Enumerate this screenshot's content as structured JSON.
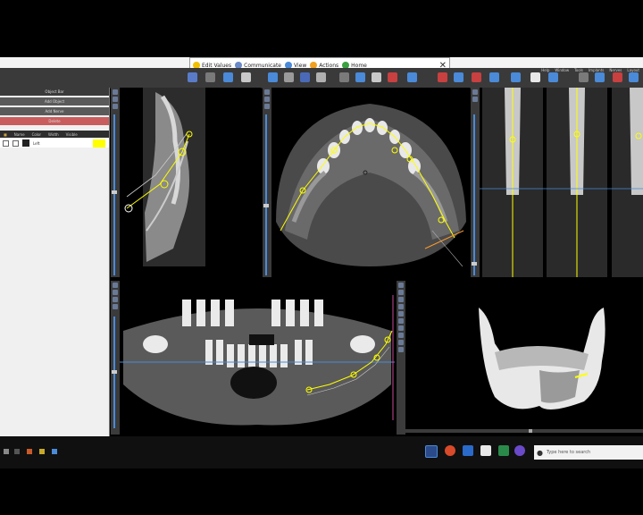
{
  "ribbon": {
    "items": [
      {
        "label": "Edit Values",
        "icon": "smiley-icon"
      },
      {
        "label": "Communicate",
        "icon": "users-icon"
      },
      {
        "label": "View",
        "icon": "eye-icon"
      },
      {
        "label": "Actions",
        "icon": "star-icon"
      },
      {
        "label": "Home",
        "icon": "refresh-icon"
      }
    ],
    "close": "✕"
  },
  "menu": [
    "Help",
    "Window",
    "Tools",
    "Implants",
    "Nerves",
    "Layout",
    "Help",
    "Help",
    "Help"
  ],
  "left_panel": {
    "title": "Object Bar",
    "buttons": [
      "Add Object",
      "Add Nerve",
      "Delete"
    ],
    "object_header": [
      "Name",
      "Color",
      "Width",
      "Visible"
    ],
    "object_row": {
      "name": "Left",
      "color": "#ffff00"
    }
  },
  "taskbar": {
    "search_placeholder": "Type here to search"
  },
  "colors": {
    "accent_blue": "#4a8ad8",
    "nerve_yellow": "#ffff00",
    "delete_red": "#c95d5d"
  }
}
